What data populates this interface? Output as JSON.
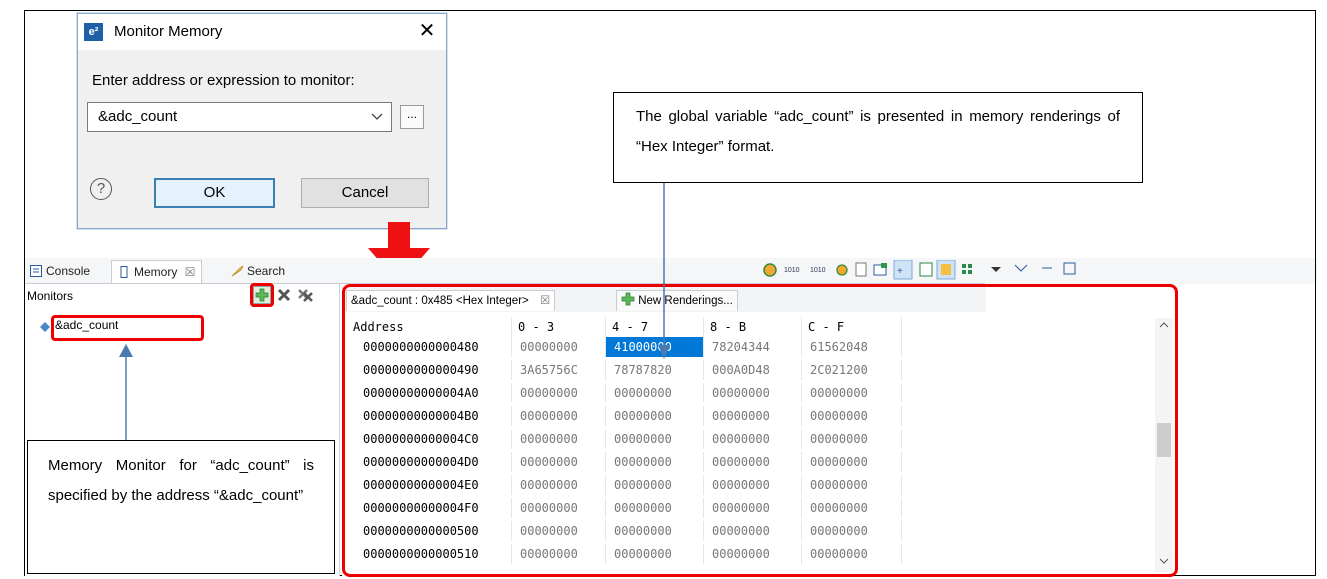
{
  "dialog": {
    "title": "Monitor Memory",
    "logo_text": "e²",
    "close_glyph": "✕",
    "prompt": "Enter address or expression to monitor:",
    "input_value": "&adc_count",
    "browse_label": "...",
    "help_glyph": "?",
    "ok_label": "OK",
    "cancel_label": "Cancel"
  },
  "tabs": [
    {
      "label": "Console",
      "icon": "console-icon"
    },
    {
      "label": "Memory",
      "icon": "memory-icon"
    },
    {
      "label": "Search",
      "icon": "search-icon"
    }
  ],
  "tab_close_glyph": "☒",
  "monitors": {
    "title": "Monitors",
    "items": [
      "&adc_count"
    ]
  },
  "rendering": {
    "tab_label": "&adc_count : 0x485 <Hex Integer>",
    "new_tab_label": "New Renderings...",
    "close_glyph": "☒"
  },
  "table": {
    "headers": [
      "Address",
      "0 - 3",
      "4 - 7",
      "8 - B",
      "C - F"
    ],
    "rows": [
      [
        "0000000000000480",
        "00000000",
        "41000000",
        "78204344",
        "61562048"
      ],
      [
        "0000000000000490",
        "3A65756C",
        "78787820",
        "000A0D48",
        "2C021200"
      ],
      [
        "00000000000004A0",
        "00000000",
        "00000000",
        "00000000",
        "00000000"
      ],
      [
        "00000000000004B0",
        "00000000",
        "00000000",
        "00000000",
        "00000000"
      ],
      [
        "00000000000004C0",
        "00000000",
        "00000000",
        "00000000",
        "00000000"
      ],
      [
        "00000000000004D0",
        "00000000",
        "00000000",
        "00000000",
        "00000000"
      ],
      [
        "00000000000004E0",
        "00000000",
        "00000000",
        "00000000",
        "00000000"
      ],
      [
        "00000000000004F0",
        "00000000",
        "00000000",
        "00000000",
        "00000000"
      ],
      [
        "0000000000000500",
        "00000000",
        "00000000",
        "00000000",
        "00000000"
      ],
      [
        "0000000000000510",
        "00000000",
        "00000000",
        "00000000",
        "00000000"
      ]
    ]
  },
  "callouts": {
    "top": "The global variable “adc_count” is presented in memory renderings of “Hex Integer” format.",
    "left": "Memory Monitor for “adc_count” is specified by the address “&adc_count”"
  },
  "colors": {
    "accent_red": "#ee1111",
    "selection": "#0078d7",
    "arrow_blue": "#4a7ab0"
  }
}
